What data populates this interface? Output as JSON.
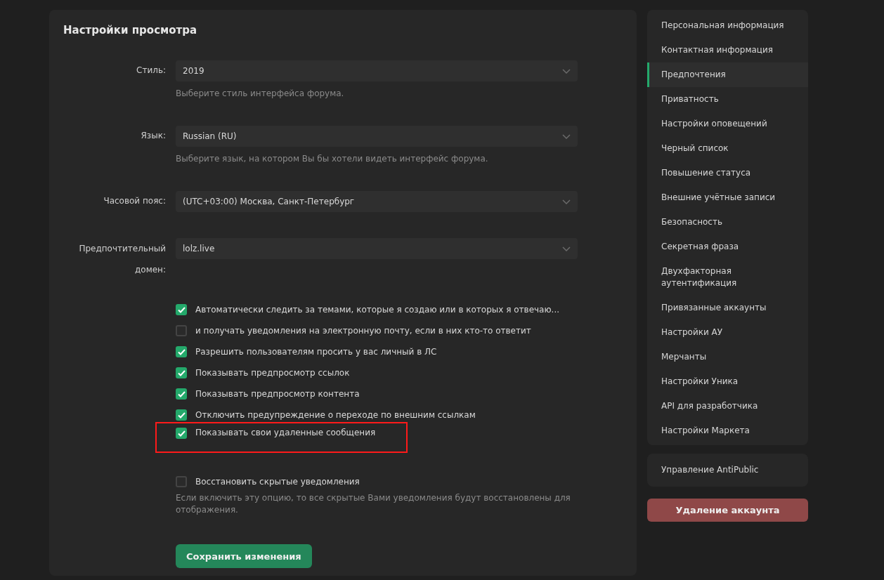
{
  "panel": {
    "title": "Настройки просмотра",
    "fields": [
      {
        "label": "Стиль:",
        "value": "2019",
        "hint": "Выберите стиль интерфейса форума."
      },
      {
        "label": "Язык:",
        "value": "Russian (RU)",
        "hint": "Выберите язык, на котором Вы бы хотели видеть интерфейс форума."
      },
      {
        "label": "Часовой пояс:",
        "value": "(UTC+03:00) Москва, Санкт-Петербург"
      },
      {
        "label": "Предпочтительный домен:",
        "value": "lolz.live"
      }
    ],
    "options": [
      {
        "label": "Автоматически следить за темами, которые я создаю или в которых я отвечаю...",
        "checked": true,
        "highlighted": false
      },
      {
        "label": "и получать уведомления на электронную почту, если в них кто-то ответит",
        "checked": false,
        "highlighted": false
      },
      {
        "label": "Разрешить пользователям просить у вас личный в ЛС",
        "checked": true,
        "highlighted": false
      },
      {
        "label": "Показывать предпросмотр ссылок",
        "checked": true,
        "highlighted": false
      },
      {
        "label": "Показывать предпросмотр контента",
        "checked": true,
        "highlighted": false
      },
      {
        "label": "Отключить предупреждение о переходе по внешним ссылкам",
        "checked": true,
        "highlighted": false
      },
      {
        "label": "Показывать свои удаленные сообщения",
        "checked": true,
        "highlighted": true
      }
    ],
    "restore": {
      "label": "Восстановить скрытые уведомления",
      "checked": false,
      "hint": "Если включить эту опцию, то все скрытые Вами уведомления будут восстановлены для отображения."
    },
    "save_button": "Сохранить изменения"
  },
  "sidebar": {
    "items": [
      {
        "label": "Персональная информация",
        "selected": false
      },
      {
        "label": "Контактная информация",
        "selected": false
      },
      {
        "label": "Предпочтения",
        "selected": true
      },
      {
        "label": "Приватность",
        "selected": false
      },
      {
        "label": "Настройки оповещений",
        "selected": false
      },
      {
        "label": "Черный список",
        "selected": false
      },
      {
        "label": "Повышение статуса",
        "selected": false
      },
      {
        "label": "Внешние учётные записи",
        "selected": false
      },
      {
        "label": "Безопасность",
        "selected": false
      },
      {
        "label": "Секретная фраза",
        "selected": false
      },
      {
        "label": "Двухфакторная аутентификация",
        "selected": false
      },
      {
        "label": "Привязанные аккаунты",
        "selected": false
      },
      {
        "label": "Настройки АУ",
        "selected": false
      },
      {
        "label": "Мерчанты",
        "selected": false
      },
      {
        "label": "Настройки Уника",
        "selected": false
      },
      {
        "label": "API для разработчика",
        "selected": false
      },
      {
        "label": "Настройки Маркета",
        "selected": false
      }
    ],
    "extra_item": "Управление AntiPublic",
    "delete_button": "Удаление аккаунта"
  }
}
